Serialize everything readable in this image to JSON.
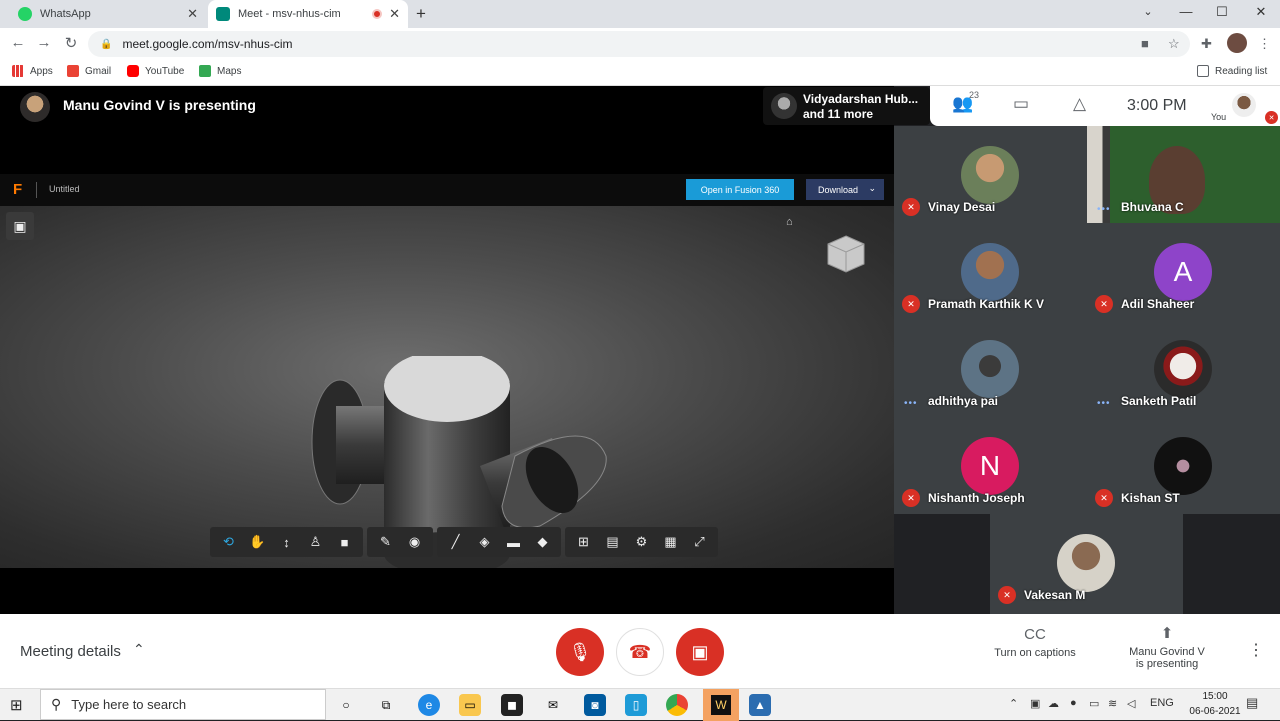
{
  "tabs": [
    {
      "title": "WhatsApp",
      "favicon": "whatsapp-icon",
      "color": "#25d366"
    },
    {
      "title": "Meet - msv-nhus-cim",
      "favicon": "meet-icon",
      "color": "#00897b"
    }
  ],
  "url": "meet.google.com/msv-nhus-cim",
  "bookmarks": [
    {
      "label": "Apps",
      "icon": "apps-grid-icon"
    },
    {
      "label": "Gmail",
      "icon": "gmail-icon"
    },
    {
      "label": "YouTube",
      "icon": "youtube-icon"
    },
    {
      "label": "Maps",
      "icon": "maps-icon"
    }
  ],
  "reading_list": "Reading list",
  "presentation": {
    "title": "Manu Govind V is presenting",
    "fusion": {
      "logo": "F",
      "document": "Untitled",
      "open_button": "Open in Fusion 360",
      "download_button": "Download"
    }
  },
  "others": {
    "name": "Vidyadarshan Hub...",
    "more": "and 11 more"
  },
  "topright": {
    "people_count": "23",
    "clock": "3:00 PM",
    "self_label": "You"
  },
  "participants": [
    {
      "name": "Vinay Desai",
      "muted": true,
      "photo": "#6b7f5a"
    },
    {
      "name": "Bhuvana C",
      "muted": false,
      "photo": "#4a3b36"
    },
    {
      "name": "Pramath Karthik K V",
      "muted": true,
      "photo": "#4f6a8a"
    },
    {
      "name": "Adil Shaheer",
      "muted": true,
      "letter": "A",
      "color": "#8e44c9"
    },
    {
      "name": "adhithya pai",
      "muted": false,
      "photo": "#5d7385"
    },
    {
      "name": "Sanketh Patil",
      "muted": false,
      "photo": "#c9c2bd"
    },
    {
      "name": "Nishanth Joseph",
      "muted": true,
      "letter": "N",
      "color": "#d81b60"
    },
    {
      "name": "Kishan ST",
      "muted": true,
      "photo": "#2a2a2a"
    },
    {
      "name": "Vakesan M",
      "muted": true,
      "photo": "#d6d2c8"
    }
  ],
  "controls": {
    "meeting_details": "Meeting details",
    "captions": "Turn on captions",
    "presenting_line1": "Manu Govind V",
    "presenting_line2": "is presenting"
  },
  "taskbar": {
    "search_placeholder": "Type here to search",
    "language": "ENG",
    "time": "15:00",
    "date": "06-06-2021"
  }
}
